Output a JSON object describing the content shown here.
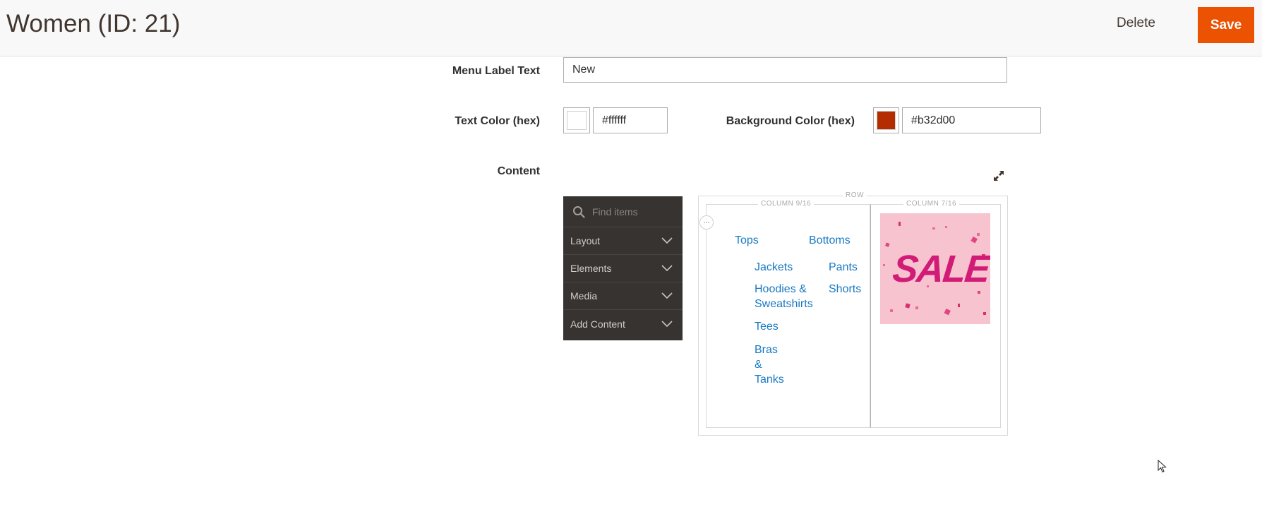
{
  "header": {
    "title": "Women (ID: 21)",
    "delete_label": "Delete",
    "save_label": "Save",
    "save_color": "#eb5202"
  },
  "form": {
    "menu_label": {
      "label": "Menu Label Text",
      "value": "New"
    },
    "text_color": {
      "label": "Text Color (hex)",
      "value": "#ffffff",
      "swatch": "#ffffff"
    },
    "background_color": {
      "label": "Background Color (hex)",
      "value": "#b32d00",
      "swatch": "#b32d00"
    },
    "content": {
      "label": "Content"
    }
  },
  "panel": {
    "search_placeholder": "Find items",
    "items": [
      {
        "label": "Layout"
      },
      {
        "label": "Elements"
      },
      {
        "label": "Media"
      },
      {
        "label": "Add Content"
      }
    ]
  },
  "stage": {
    "row_label": "ROW",
    "column1": {
      "label": "COLUMN 9/16",
      "links": {
        "tops": "Tops",
        "bottoms": "Bottoms",
        "jackets": "Jackets",
        "pants": "Pants",
        "hoodies_1": "Hoodies &",
        "hoodies_2": "Sweatshirts",
        "shorts": "Shorts",
        "tees": "Tees",
        "bras_1": "Bras",
        "bras_2": "&",
        "bras_3": "Tanks"
      }
    },
    "column2": {
      "label": "COLUMN 7/16",
      "image_text": "SALE"
    }
  }
}
